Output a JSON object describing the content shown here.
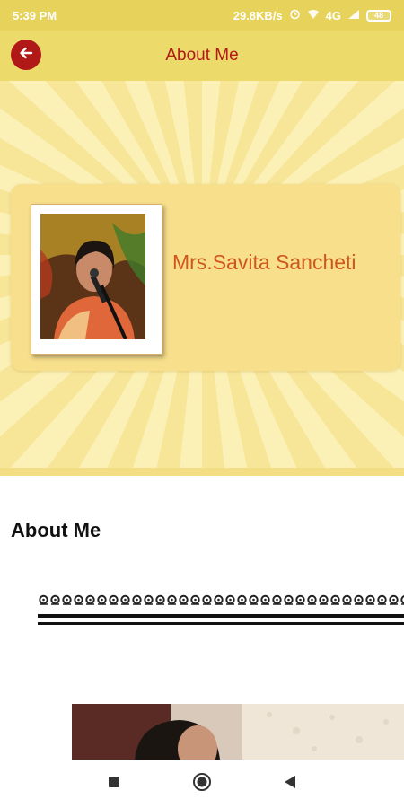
{
  "status_bar": {
    "time": "5:39 PM",
    "speed": "29.8KB/s",
    "network": "4G",
    "battery": "48",
    "icons": [
      "alarm-icon",
      "wifi-icon",
      "signal-icon",
      "battery-icon"
    ]
  },
  "app_bar": {
    "title": "About Me",
    "back_icon": "arrow-left-icon"
  },
  "profile": {
    "name": "Mrs.Savita Sancheti"
  },
  "content": {
    "section_title": "About Me"
  },
  "colors": {
    "status_bar_bg": "#e7d35c",
    "app_bar_bg": "#ecda6a",
    "accent_red": "#b11818",
    "name_orange": "#d0571c",
    "card_bg": "#f7df8c"
  },
  "nav_bar": {
    "icons": [
      "recents-square-icon",
      "home-circle-icon",
      "back-triangle-icon"
    ]
  }
}
